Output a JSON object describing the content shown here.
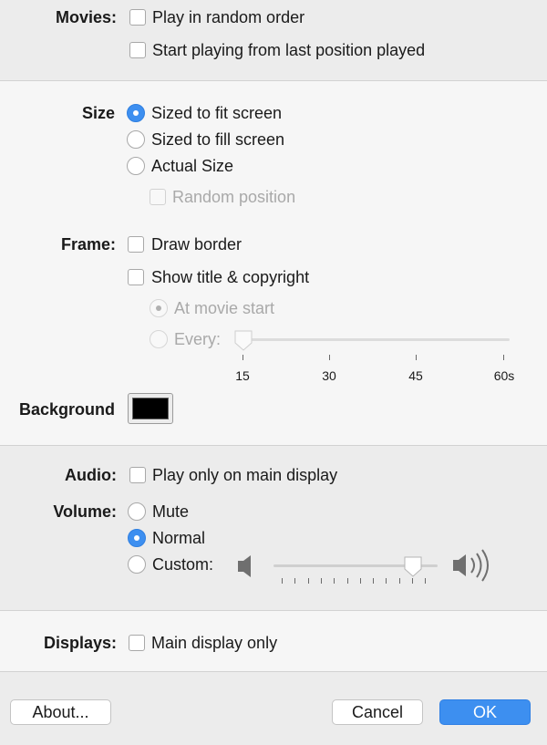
{
  "movies": {
    "label": "Movies:",
    "random_order": "Play in random order",
    "resume": "Start playing from last position played"
  },
  "size": {
    "label": "Size",
    "fit": "Sized to fit screen",
    "fill": "Sized to fill screen",
    "actual": "Actual Size",
    "random_position": "Random position"
  },
  "frame": {
    "label": "Frame:",
    "draw_border": "Draw border",
    "show_title": "Show title & copyright",
    "at_start": "At movie start",
    "every": "Every:",
    "slider_value": "15",
    "ticks": [
      "15",
      "30",
      "45",
      "60s"
    ]
  },
  "background": {
    "label": "Background",
    "color": "#000000"
  },
  "audio": {
    "label": "Audio:",
    "main_only": "Play only on main display"
  },
  "volume": {
    "label": "Volume:",
    "mute": "Mute",
    "normal": "Normal",
    "custom": "Custom:",
    "slider_fraction": 0.85
  },
  "displays": {
    "label": "Displays:",
    "main_only": "Main display only"
  },
  "buttons": {
    "about": "About...",
    "cancel": "Cancel",
    "ok": "OK"
  }
}
